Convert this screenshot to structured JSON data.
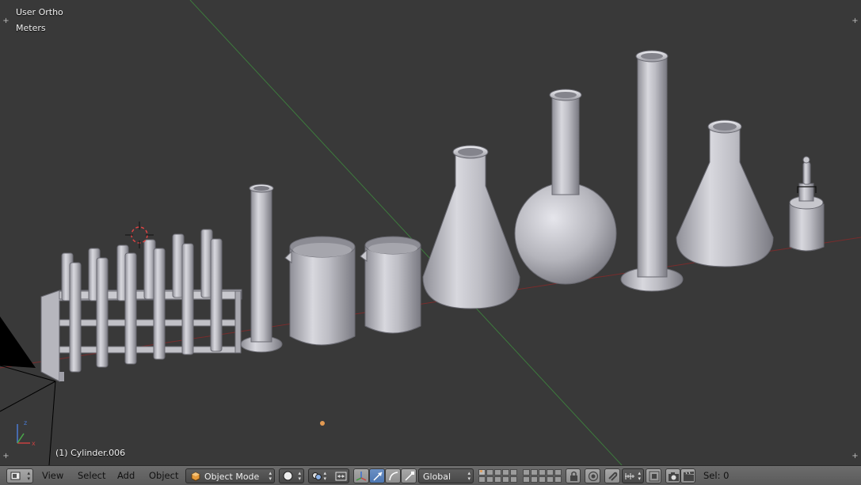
{
  "viewport": {
    "view_name": "User Ortho",
    "units": "Meters",
    "active_object": "(1) Cylinder.006"
  },
  "header": {
    "menus": {
      "view": "View",
      "select": "Select",
      "add": "Add",
      "object": "Object"
    },
    "mode": "Object Mode",
    "orientation": "Global",
    "sel_label": "Sel: 0"
  },
  "colors": {
    "viewport_bg": "#393939",
    "x_axis": "#8a2d2d",
    "y_axis": "#3d7a3d",
    "header_bg": "#666666",
    "active_blue": "#5680c2"
  }
}
